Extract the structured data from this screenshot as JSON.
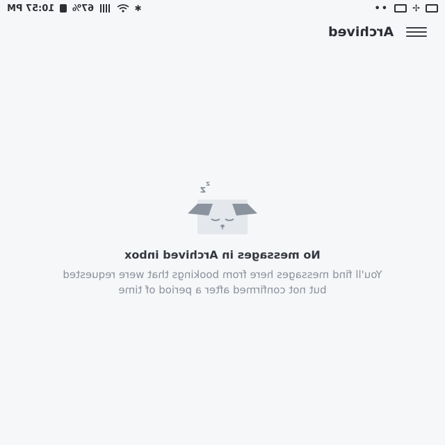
{
  "status_bar": {
    "time": "10:57 PM",
    "battery": "67%",
    "dots": "••"
  },
  "app_bar": {
    "title": "Archived"
  },
  "empty_state": {
    "title": "No messages in Archived inbox",
    "description": "You'll find messages here from bookings that were requested but not confirmed after a period of time"
  },
  "colors": {
    "background": "#f6f7f9",
    "illustration": "#8a939e",
    "text_primary": "#343840",
    "text_secondary": "#8a909a"
  }
}
